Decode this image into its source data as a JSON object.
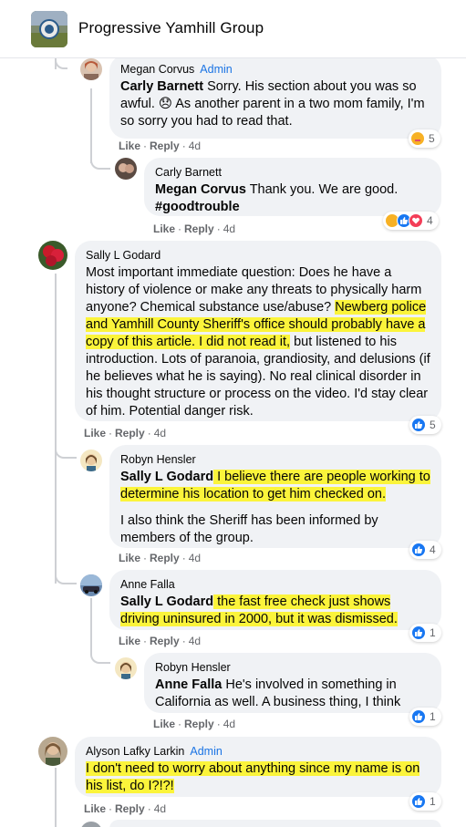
{
  "group": {
    "name": "Progressive Yamhill Group"
  },
  "actions": {
    "like": "Like",
    "reply": "Reply"
  },
  "comments": [
    {
      "author": "Megan Corvus",
      "badge": "Admin",
      "tag": "Carly Barnett",
      "text": " Sorry. His section about you was so awful. 😞 As another parent in a two mom family, I'm so sorry you had to read that.",
      "time": "4d",
      "reaction_count": "5"
    },
    {
      "author": "Carly Barnett",
      "tag": "Megan Corvus",
      "text": " Thank you. We are good. ",
      "hashtag": "#goodtrouble",
      "time": "4d",
      "reaction_count": "4"
    },
    {
      "author": "Sally L Godard",
      "text_a": "Most important immediate question: Does he have a history of violence or make any threats to physically harm anyone? Chemical substance use/abuse? ",
      "text_hl": "Newberg police and Yamhill County Sheriff's office should probably have a copy of this article. I did not read it,",
      "text_b": " but listened to his introduction. Lots of paranoia, grandiosity, and delusions (if he believes what he is saying). No real clinical disorder in his thought structure or process on the video. I'd stay clear of him. Potential danger risk.",
      "time": "4d",
      "reaction_count": "5"
    },
    {
      "author": "Robyn Hensler",
      "tag": "Sally L Godard",
      "text": " I believe there are people working to determine his location to get him checked on.",
      "text2": "I also think the Sheriff has been informed by members of the group.",
      "time": "4d",
      "reaction_count": "4"
    },
    {
      "author": "Anne Falla",
      "tag": "Sally L Godard",
      "text": " the fast free check just shows driving uninsured in 2000, but it was dismissed.",
      "time": "4d",
      "reaction_count": "1"
    },
    {
      "author": "Robyn Hensler",
      "tag": "Anne Falla",
      "text": " He's involved in something in California as well. A business thing, I think",
      "time": "4d",
      "reaction_count": "1"
    },
    {
      "author": "Alyson Lafky Larkin",
      "badge": "Admin",
      "text": "I don't need to worry about anything since my name is on his list, do I?!?!",
      "time": "4d",
      "reaction_count": "1"
    }
  ],
  "colors": {
    "accent": "#1b74e4",
    "highlight": "#fbf43b",
    "bubble": "#f0f2f5",
    "meta": "#65676b"
  }
}
